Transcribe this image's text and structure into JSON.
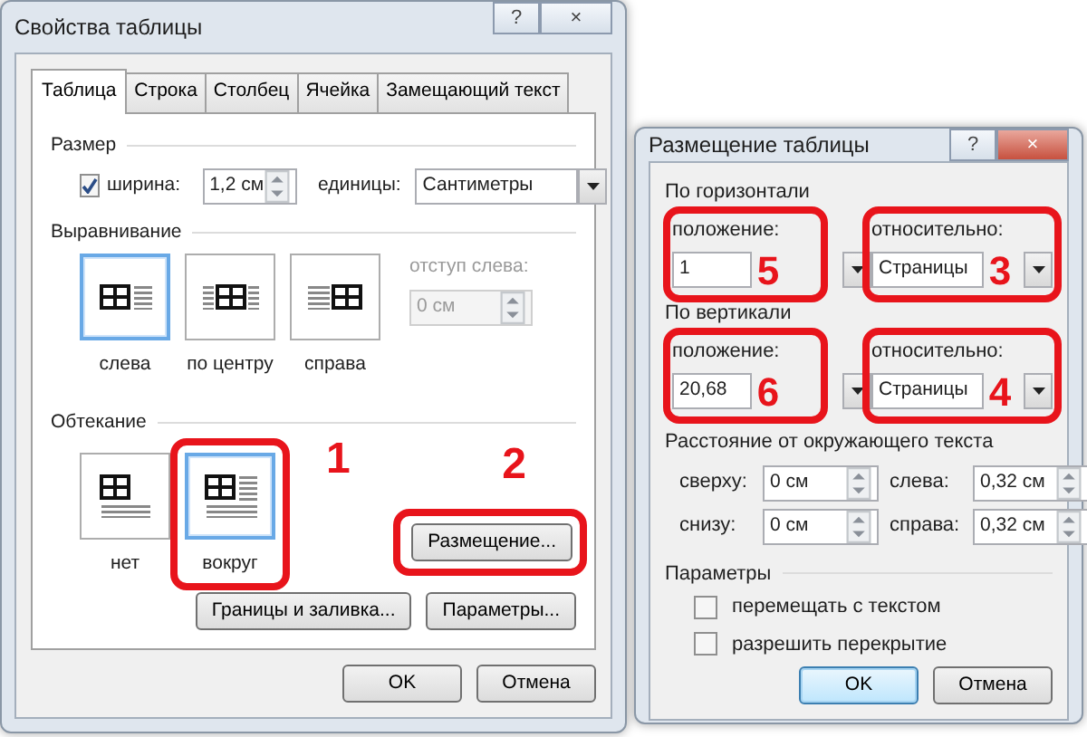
{
  "table_properties": {
    "title": "Свойства таблицы",
    "help": "?",
    "close": "×",
    "tabs": [
      {
        "label": "Таблица",
        "selected": true
      },
      {
        "label": "Строка",
        "selected": false
      },
      {
        "label": "Столбец",
        "selected": false
      },
      {
        "label": "Ячейка",
        "selected": false
      },
      {
        "label": "Замещающий текст",
        "selected": false
      }
    ],
    "size": {
      "heading": "Размер",
      "width_label": "ширина:",
      "width_checked": true,
      "width_value": "1,2 см",
      "units_label": "единицы:",
      "units_value": "Сантиметры"
    },
    "alignment": {
      "heading": "Выравнивание",
      "options": [
        {
          "label": "слева",
          "kind": "left",
          "selected": true
        },
        {
          "label": "по центру",
          "kind": "center",
          "selected": false
        },
        {
          "label": "справа",
          "kind": "right",
          "selected": false
        }
      ],
      "indent_label": "отступ слева:",
      "indent_value": "0 см",
      "indent_disabled": true
    },
    "wrapping": {
      "heading": "Обтекание",
      "options": [
        {
          "label": "нет",
          "kind": "none",
          "selected": false
        },
        {
          "label": "вокруг",
          "kind": "around",
          "selected": true,
          "callout": "1"
        }
      ],
      "positioning_button": {
        "label": "Размещение...",
        "callout": "2"
      }
    },
    "buttons": [
      "Границы и заливка...",
      "Параметры..."
    ],
    "footer_buttons": [
      {
        "label": "OK",
        "default": false
      },
      {
        "label": "Отмена",
        "default": false
      }
    ]
  },
  "table_positioning": {
    "title": "Размещение таблицы",
    "help": "?",
    "close": "×",
    "groups": [
      {
        "heading": "По горизонтали",
        "position_label": "положение:",
        "position_value": "1",
        "position_callout": "5",
        "relative_label": "относительно:",
        "relative_value": "Страницы",
        "relative_callout": "3"
      },
      {
        "heading": "По вертикали",
        "position_label": "положение:",
        "position_value": "20,68",
        "position_callout": "6",
        "relative_label": "относительно:",
        "relative_value": "Страницы",
        "relative_callout": "4"
      }
    ],
    "distance": {
      "heading": "Расстояние от окружающего текста",
      "fields": [
        {
          "label": "сверху:",
          "value": "0 см"
        },
        {
          "label": "слева:",
          "value": "0,32 см"
        },
        {
          "label": "снизу:",
          "value": "0 см"
        },
        {
          "label": "справа:",
          "value": "0,32 см"
        }
      ]
    },
    "options": {
      "heading": "Параметры",
      "checkboxes": [
        {
          "label": "перемещать с текстом",
          "checked": false
        },
        {
          "label": "разрешить перекрытие",
          "checked": false
        }
      ]
    },
    "footer_buttons": [
      {
        "label": "OK",
        "default": true
      },
      {
        "label": "Отмена",
        "default": false
      }
    ]
  }
}
